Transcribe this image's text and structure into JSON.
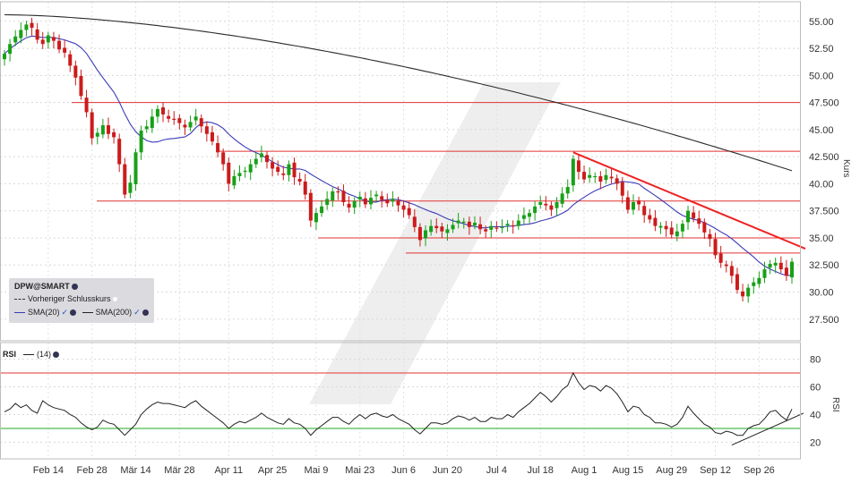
{
  "chart_data": [
    {
      "type": "candlestick",
      "symbol": "DPW@SMART",
      "ylabel": "Kurs",
      "ylim": [
        25.5,
        56.8
      ],
      "y_ticks": [
        "55.00",
        "52.50",
        "50.00",
        "47.500",
        "45.00",
        "42.500",
        "40.00",
        "37.500",
        "35.00",
        "32.500",
        "30.00",
        "27.500"
      ],
      "x_ticks": [
        "Feb 14",
        "Feb 28",
        "Mär 14",
        "Mär 28",
        "Apr 11",
        "Apr 25",
        "Mai 9",
        "Mai 23",
        "Jun 6",
        "Jun 20",
        "Jul 4",
        "Jul 18",
        "Aug 1",
        "Aug 15",
        "Aug 29",
        "Sep 12",
        "Sep 26"
      ],
      "legend": {
        "prev_close": "Vorheriger Schlusskurs",
        "sma20": "SMA(20)",
        "sma200": "SMA(200)"
      },
      "close": [
        52.0,
        52.9,
        53.6,
        54.2,
        54.7,
        54.4,
        53.3,
        52.9,
        53.7,
        53.2,
        52.4,
        52.1,
        50.9,
        49.8,
        48.1,
        46.6,
        44.2,
        44.7,
        45.4,
        44.6,
        44.3,
        41.8,
        39.0,
        40.1,
        42.9,
        44.9,
        45.3,
        46.2,
        46.9,
        46.4,
        46.0,
        45.9,
        45.6,
        45.2,
        45.7,
        46.2,
        45.3,
        44.6,
        43.9,
        42.9,
        41.8,
        40.0,
        40.7,
        41.0,
        41.2,
        41.8,
        42.3,
        42.8,
        42.0,
        41.4,
        41.1,
        40.8,
        41.8,
        40.6,
        40.2,
        39.0,
        36.6,
        37.3,
        37.9,
        38.6,
        39.3,
        39.2,
        38.3,
        37.8,
        38.4,
        38.8,
        38.1,
        38.7,
        39.0,
        38.5,
        38.2,
        38.6,
        38.0,
        37.6,
        37.1,
        36.0,
        34.8,
        35.7,
        36.1,
        35.9,
        35.6,
        35.8,
        36.2,
        36.6,
        36.5,
        36.0,
        36.4,
        35.8,
        35.6,
        36.1,
        35.9,
        36.0,
        36.3,
        36.1,
        36.6,
        37.1,
        37.3,
        37.9,
        38.3,
        38.0,
        37.6,
        38.3,
        39.1,
        39.7,
        42.3,
        41.1,
        40.4,
        40.8,
        40.7,
        40.2,
        40.8,
        40.5,
        40.0,
        38.9,
        37.6,
        38.3,
        38.1,
        37.1,
        36.7,
        36.1,
        36.1,
        35.8,
        35.3,
        35.6,
        36.3,
        37.5,
        36.8,
        36.3,
        35.5,
        34.9,
        33.4,
        32.7,
        32.4,
        31.5,
        30.2,
        29.6,
        30.4,
        30.9,
        31.3,
        32.1,
        32.6,
        32.7,
        32.1,
        31.5,
        32.8
      ],
      "hlines_red": [
        47.5,
        43.0,
        38.4,
        35.0,
        33.6
      ],
      "trendline": [
        [
          42.9,
          104
        ],
        [
          34.0,
          148
        ]
      ],
      "sma20_last": 33.2,
      "sma200_last": 41.2,
      "colors": {
        "up": "#18a018",
        "down": "#cc1b1b",
        "sma20": "#3b3bb8",
        "sma200": "#2a2a2a",
        "hline": "#e23333",
        "trend": "#ee2222"
      }
    },
    {
      "type": "line",
      "name": "RSI",
      "ylabel": "RSI",
      "period": "(14)",
      "ylim": [
        8,
        92
      ],
      "y_ticks": [
        "80",
        "60",
        "40",
        "20"
      ],
      "upper_line": 70,
      "lower_line": 30,
      "values": [
        42,
        44,
        48,
        45,
        47,
        43,
        41,
        50,
        47,
        45,
        44,
        43,
        40,
        38,
        34,
        31,
        29,
        31,
        36,
        34,
        33,
        29,
        25,
        29,
        33,
        40,
        44,
        47,
        49,
        48,
        48,
        47,
        46,
        45,
        48,
        50,
        46,
        43,
        40,
        37,
        34,
        30,
        33,
        35,
        34,
        36,
        38,
        41,
        38,
        36,
        34,
        33,
        37,
        34,
        33,
        30,
        25,
        29,
        32,
        35,
        38,
        38,
        35,
        33,
        37,
        40,
        37,
        40,
        41,
        39,
        38,
        40,
        37,
        35,
        33,
        29,
        26,
        30,
        34,
        34,
        33,
        34,
        37,
        39,
        38,
        36,
        38,
        35,
        35,
        38,
        37,
        37,
        40,
        38,
        42,
        45,
        48,
        52,
        56,
        53,
        49,
        53,
        58,
        61,
        70,
        63,
        58,
        61,
        60,
        57,
        61,
        59,
        55,
        49,
        42,
        46,
        45,
        40,
        38,
        34,
        34,
        33,
        31,
        33,
        38,
        46,
        41,
        37,
        33,
        31,
        27,
        26,
        28,
        27,
        25,
        25,
        30,
        32,
        33,
        37,
        42,
        43,
        39,
        36,
        44
      ],
      "rsi_trendline": [
        [
          18,
          133
        ],
        [
          41,
          148
        ]
      ],
      "colors": {
        "line": "#222222",
        "upper": "#e23333",
        "lower": "#22aa22"
      }
    }
  ]
}
